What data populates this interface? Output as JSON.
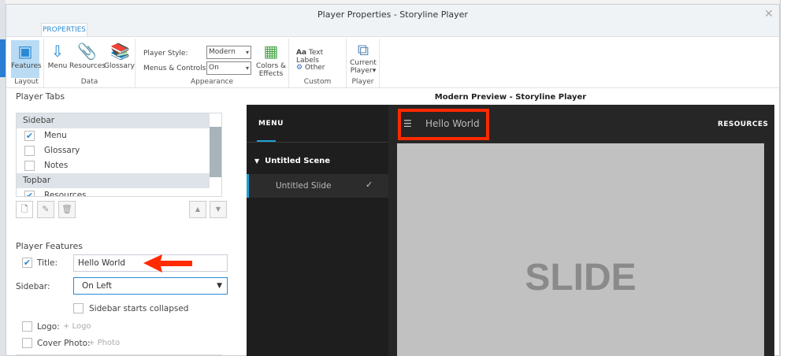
{
  "window": {
    "title": "Player Properties - Storyline Player",
    "tab": "PROPERTIES"
  },
  "ribbon": {
    "layout": {
      "label": "Layout",
      "features": "Features"
    },
    "data": {
      "label": "Data",
      "menu": "Menu",
      "resources": "Resources",
      "glossary": "Glossary"
    },
    "appearance": {
      "label": "Appearance",
      "player_style_label": "Player Style:",
      "player_style": "Modern",
      "menus_label": "Menus & Controls:",
      "menus": "On",
      "colors": "Colors &",
      "effects": "Effects"
    },
    "custom": {
      "label": "Custom",
      "text_labels": "Text Labels",
      "other": "Other"
    },
    "player": {
      "label": "Player",
      "current": "Current",
      "player": "Player"
    }
  },
  "tabs": {
    "heading": "Player Tabs",
    "items": [
      {
        "label": "Sidebar"
      },
      {
        "label": "Menu",
        "checked": true
      },
      {
        "label": "Glossary",
        "checked": false
      },
      {
        "label": "Notes",
        "checked": false
      },
      {
        "label": "Topbar"
      },
      {
        "label": "Resources",
        "checked": true
      }
    ]
  },
  "features": {
    "heading": "Player Features",
    "title_label": "Title:",
    "title_value": "Hello World",
    "sidebar_label": "Sidebar:",
    "sidebar_value": "On Left",
    "collapsed": "Sidebar starts collapsed",
    "logo_label": "Logo:",
    "logo_add": "+ Logo",
    "cover_label": "Cover Photo:",
    "cover_add": "+ Photo"
  },
  "preview": {
    "title": "Modern Preview - Storyline Player",
    "menu_tab": "MENU",
    "scene": "Untitled Scene",
    "slide": "Untitled Slide",
    "player_title": "Hello World",
    "resources": "RESOURCES",
    "slide_text": "SLIDE"
  },
  "colors": {
    "accent": "#1fa0d8",
    "annotation": "#ff2a00"
  }
}
